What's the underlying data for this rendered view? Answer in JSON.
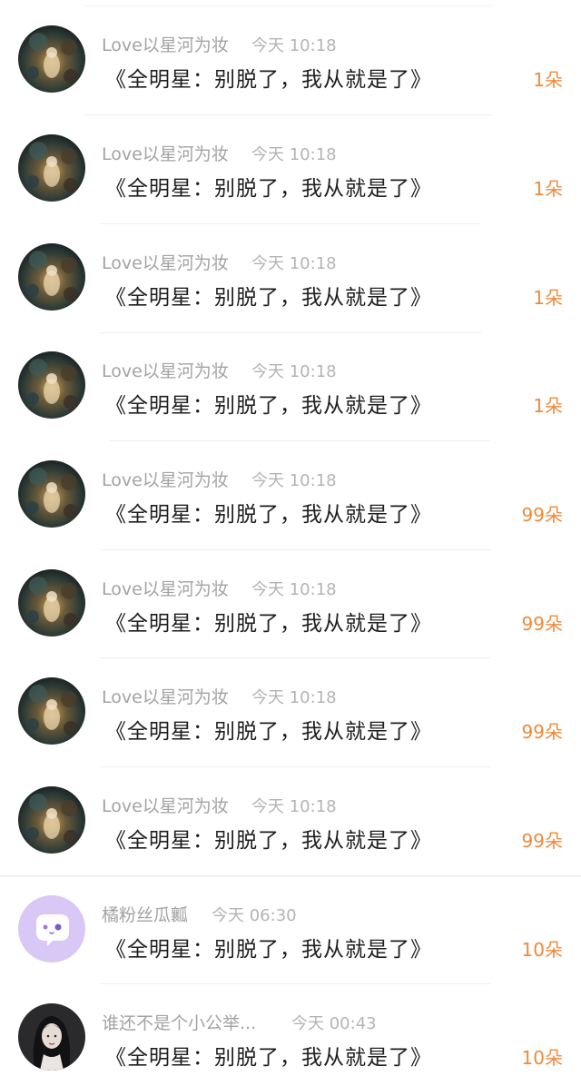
{
  "colors": {
    "accent": "#f08a3a",
    "name_text": "#a3a3a3",
    "time_text": "#b4b4b4",
    "title_text": "#1e1e1e",
    "chat_avatar_bg": "#d9c8f5"
  },
  "rows": [
    {
      "avatar": "galaxy-avatar",
      "name": "Love以星河为妆",
      "time": "今天 10:18",
      "title": "《全明星：别脱了，我从就是了》",
      "count": "1朵"
    },
    {
      "avatar": "galaxy-avatar",
      "name": "Love以星河为妆",
      "time": "今天 10:18",
      "title": "《全明星：别脱了，我从就是了》",
      "count": "1朵"
    },
    {
      "avatar": "galaxy-avatar",
      "name": "Love以星河为妆",
      "time": "今天 10:18",
      "title": "《全明星：别脱了，我从就是了》",
      "count": "1朵"
    },
    {
      "avatar": "galaxy-avatar",
      "name": "Love以星河为妆",
      "time": "今天 10:18",
      "title": "《全明星：别脱了，我从就是了》",
      "count": "1朵"
    },
    {
      "avatar": "galaxy-avatar",
      "name": "Love以星河为妆",
      "time": "今天 10:18",
      "title": "《全明星：别脱了，我从就是了》",
      "count": "99朵"
    },
    {
      "avatar": "galaxy-avatar",
      "name": "Love以星河为妆",
      "time": "今天 10:18",
      "title": "《全明星：别脱了，我从就是了》",
      "count": "99朵"
    },
    {
      "avatar": "galaxy-avatar",
      "name": "Love以星河为妆",
      "time": "今天 10:18",
      "title": "《全明星：别脱了，我从就是了》",
      "count": "99朵"
    },
    {
      "avatar": "galaxy-avatar",
      "name": "Love以星河为妆",
      "time": "今天 10:18",
      "title": "《全明星：别脱了，我从就是了》",
      "count": "99朵"
    },
    {
      "avatar": "chat-bubble-avatar",
      "name": "橘粉丝瓜瓤",
      "time": "今天 06:30",
      "title": "《全明星：别脱了，我从就是了》",
      "count": "10朵"
    },
    {
      "avatar": "girl-portrait-avatar",
      "name": "谁还不是个小公举...",
      "time": "今天 00:43",
      "title": "《全明星：别脱了，我从就是了》",
      "count": "10朵"
    }
  ]
}
